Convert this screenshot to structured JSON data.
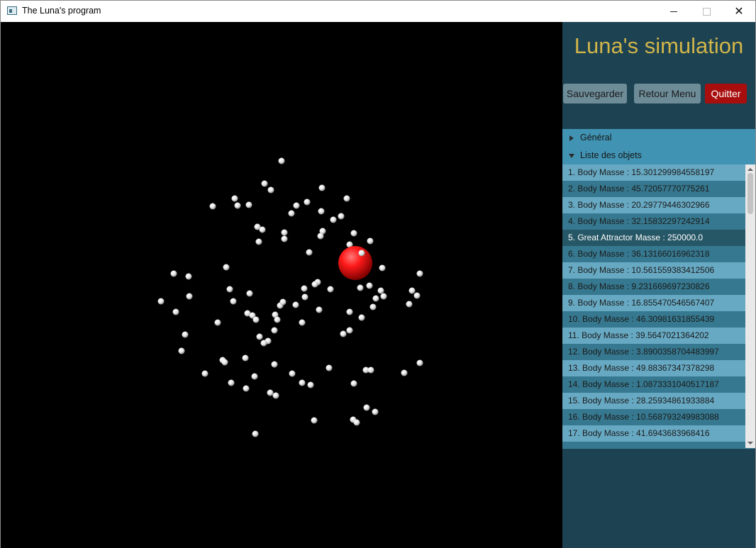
{
  "window": {
    "title": "The Luna's program",
    "minimize_icon": "minimize-icon",
    "maximize_icon": "maximize-icon",
    "close_icon": "close-icon",
    "close_glyph": "✕"
  },
  "panel": {
    "title": "Luna's simulation",
    "buttons": {
      "save": "Sauvegarder",
      "menu": "Retour Menu",
      "quit": "Quitter"
    },
    "sections": {
      "general": "Général",
      "objects": "Liste des objets"
    },
    "objects": [
      "1. Body Masse : 15.301299984558197",
      "2. Body Masse : 45.72057770775261",
      "3. Body Masse : 20.29779446302966",
      "4. Body Masse : 32.15832297242914",
      "5. Great Attractor Masse : 250000.0",
      "6. Body Masse : 36.13166016962318",
      "7. Body Masse : 10.561559383412506",
      "8. Body Masse : 9.231669697230826",
      "9. Body Masse : 16.855470546567407",
      "10. Body Masse : 46.30981631855439",
      "11. Body Masse : 39.5647021364202",
      "12. Body Masse : 3.8900358704483997",
      "13. Body Masse : 49.88367347378298",
      "14. Body Masse : 1.0873331040517187",
      "15. Body Masse : 28.25934861933884",
      "16. Body Masse : 10.568793249983088",
      "17. Body Masse : 41.6943683968416"
    ],
    "selected_index": 4
  },
  "colors": {
    "attractor": "#ff0000",
    "body": "#ffffff",
    "title": "#d0b54a",
    "quit_button": "#a80e0e",
    "panel_bg": "#1d4251"
  }
}
